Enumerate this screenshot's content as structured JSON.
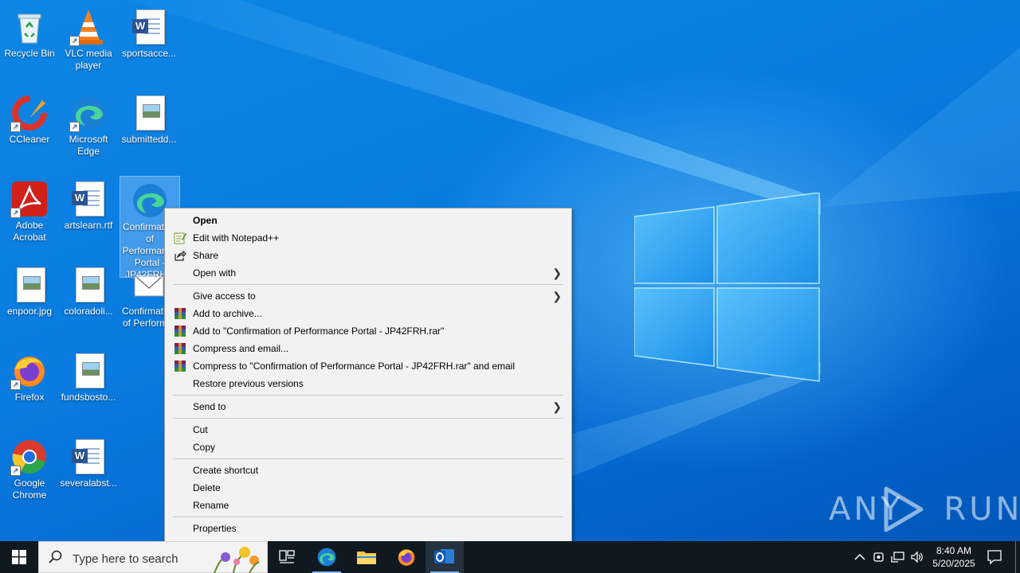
{
  "desktop": {
    "icons": [
      {
        "label": "Recycle Bin"
      },
      {
        "label": "VLC media player"
      },
      {
        "label": "sportsacce..."
      },
      {
        "label": "CCleaner"
      },
      {
        "label": "Microsoft Edge"
      },
      {
        "label": "submittedd..."
      },
      {
        "label": "Adobe Acrobat"
      },
      {
        "label": "artslearn.rtf"
      },
      {
        "label": "Confirmation of Performance Portal - JP42FRH..."
      },
      {
        "label": "enpoor.jpg"
      },
      {
        "label": "coloradoli..."
      },
      {
        "label": "Confirmation of Perform..."
      },
      {
        "label": "Firefox"
      },
      {
        "label": "fundsbosto..."
      },
      {
        "label": "Google Chrome"
      },
      {
        "label": "severalabst..."
      }
    ],
    "watermark": "ANY RUN"
  },
  "context_menu": {
    "items": [
      {
        "label": "Open"
      },
      {
        "label": "Edit with Notepad++",
        "icon": "notepadpp-icon"
      },
      {
        "label": "Share",
        "icon": "share-icon"
      },
      {
        "label": "Open with"
      },
      {
        "label": "Give access to"
      },
      {
        "label": "Add to archive...",
        "icon": "winrar-icon"
      },
      {
        "label": "Add to \"Confirmation of Performance Portal - JP42FRH.rar\"",
        "icon": "winrar-icon"
      },
      {
        "label": "Compress and email...",
        "icon": "winrar-icon"
      },
      {
        "label": "Compress to \"Confirmation of Performance Portal - JP42FRH.rar\" and email",
        "icon": "winrar-icon"
      },
      {
        "label": "Restore previous versions"
      },
      {
        "label": "Send to"
      },
      {
        "label": "Cut"
      },
      {
        "label": "Copy"
      },
      {
        "label": "Create shortcut"
      },
      {
        "label": "Delete"
      },
      {
        "label": "Rename"
      },
      {
        "label": "Properties"
      }
    ],
    "submenu_arrow": "❯"
  },
  "taskbar": {
    "search_placeholder": "Type here to search",
    "time": "8:40 AM",
    "date": "5/20/2025"
  },
  "colors": {
    "taskbar": "#101820",
    "menu_bg": "#f2f2f2",
    "desktop_blue": "#0a78d6"
  }
}
